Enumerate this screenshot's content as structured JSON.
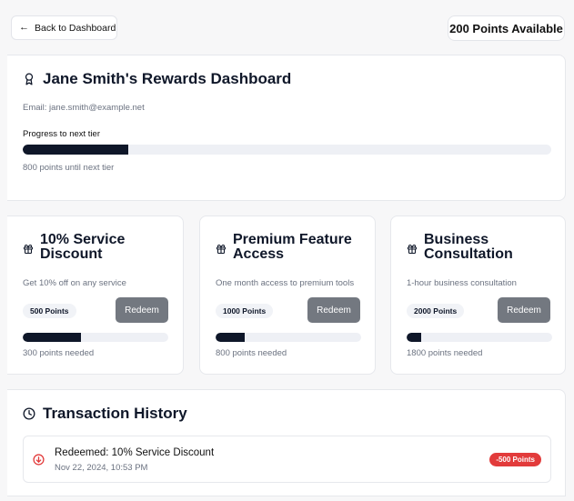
{
  "nav": {
    "back_label": "Back to Dashboard"
  },
  "points_available": "200 Points Available",
  "profile": {
    "title": "Jane Smith's Rewards Dashboard",
    "email": "Email: jane.smith@example.net",
    "progress_label": "Progress to next tier",
    "progress_fraction": 0.2,
    "until_label": "800 points until next tier"
  },
  "rewards": [
    {
      "title": "10% Service Discount",
      "description": "Get 10% off on any service",
      "cost": "500 Points",
      "redeem_label": "Redeem",
      "progress_fraction": 0.4,
      "needed": "300 points needed"
    },
    {
      "title": "Premium Feature Access",
      "description": "One month access to premium tools",
      "cost": "1000 Points",
      "redeem_label": "Redeem",
      "progress_fraction": 0.2,
      "needed": "800 points needed"
    },
    {
      "title": "Business Consultation",
      "description": "1-hour business consultation",
      "cost": "2000 Points",
      "redeem_label": "Redeem",
      "progress_fraction": 0.1,
      "needed": "1800 points needed"
    }
  ],
  "history": {
    "title": "Transaction History",
    "transactions": [
      {
        "name": "Redeemed: 10% Service Discount",
        "date": "Nov 22, 2024, 10:53 PM",
        "amount": "-500 Points"
      }
    ]
  },
  "icons": {
    "back": "arrow-left-icon",
    "award": "award-icon",
    "gift": "gift-icon",
    "clock": "clock-icon",
    "redeemed": "arrow-down-circle-icon"
  },
  "colors": {
    "primary": "#0f1729",
    "button": "#737880",
    "danger": "#e23b3b"
  }
}
